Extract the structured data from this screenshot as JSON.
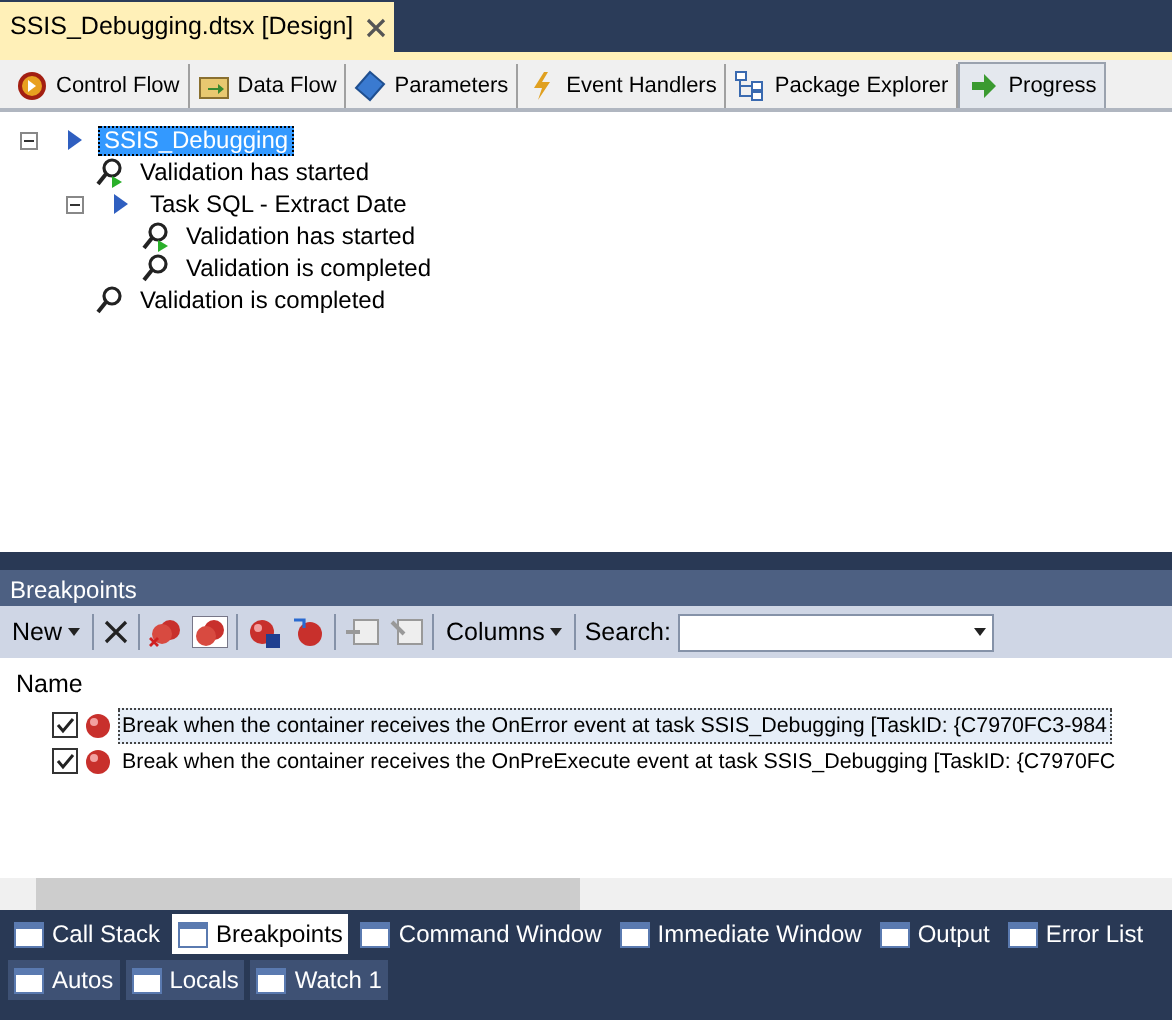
{
  "document_tab": {
    "title": "SSIS_Debugging.dtsx [Design]",
    "selected": true
  },
  "designer_tabs": [
    {
      "label": "Control Flow",
      "kind": "control",
      "selected": false
    },
    {
      "label": "Data Flow",
      "kind": "data",
      "selected": false
    },
    {
      "label": "Parameters",
      "kind": "params",
      "selected": false
    },
    {
      "label": "Event Handlers",
      "kind": "events",
      "selected": false
    },
    {
      "label": "Package Explorer",
      "kind": "explorer",
      "selected": false
    },
    {
      "label": "Progress",
      "kind": "progress",
      "selected": true
    }
  ],
  "progress_tree": [
    {
      "kind": "node",
      "label": "SSIS_Debugging",
      "expanded": true,
      "selected": true,
      "children": [
        {
          "kind": "started",
          "label": "Validation has started",
          "selected": false
        },
        {
          "kind": "node",
          "label": "Task SQL - Extract Date",
          "expanded": true,
          "selected": false,
          "children": [
            {
              "kind": "started",
              "label": "Validation has started",
              "selected": false
            },
            {
              "kind": "completed",
              "label": "Validation is completed",
              "selected": false
            }
          ]
        },
        {
          "kind": "completed",
          "label": "Validation is completed",
          "selected": false
        }
      ]
    }
  ],
  "breakpoints": {
    "title": "Breakpoints",
    "toolbar": {
      "new_label": "New",
      "columns_label": "Columns",
      "search_label": "Search:"
    },
    "columns": [
      "Name"
    ],
    "rows": [
      {
        "text": "Break when the container receives the OnError event at task SSIS_Debugging [TaskID: {C7970FC3-984",
        "checked": true,
        "selected": true
      },
      {
        "text": "Break when the container receives the OnPreExecute event at task SSIS_Debugging [TaskID: {C7970FC",
        "checked": true,
        "selected": false
      }
    ]
  },
  "bottom_tabs": [
    {
      "label": "Call Stack",
      "selected": false
    },
    {
      "label": "Breakpoints",
      "selected": true
    },
    {
      "label": "Command Window",
      "selected": false
    },
    {
      "label": "Immediate Window",
      "selected": false
    },
    {
      "label": "Output",
      "selected": false
    },
    {
      "label": "Error List",
      "selected": false
    }
  ],
  "bottom_tabs_2": [
    {
      "label": "Autos",
      "selected": false
    },
    {
      "label": "Locals",
      "selected": false
    },
    {
      "label": "Watch 1",
      "selected": false
    }
  ]
}
